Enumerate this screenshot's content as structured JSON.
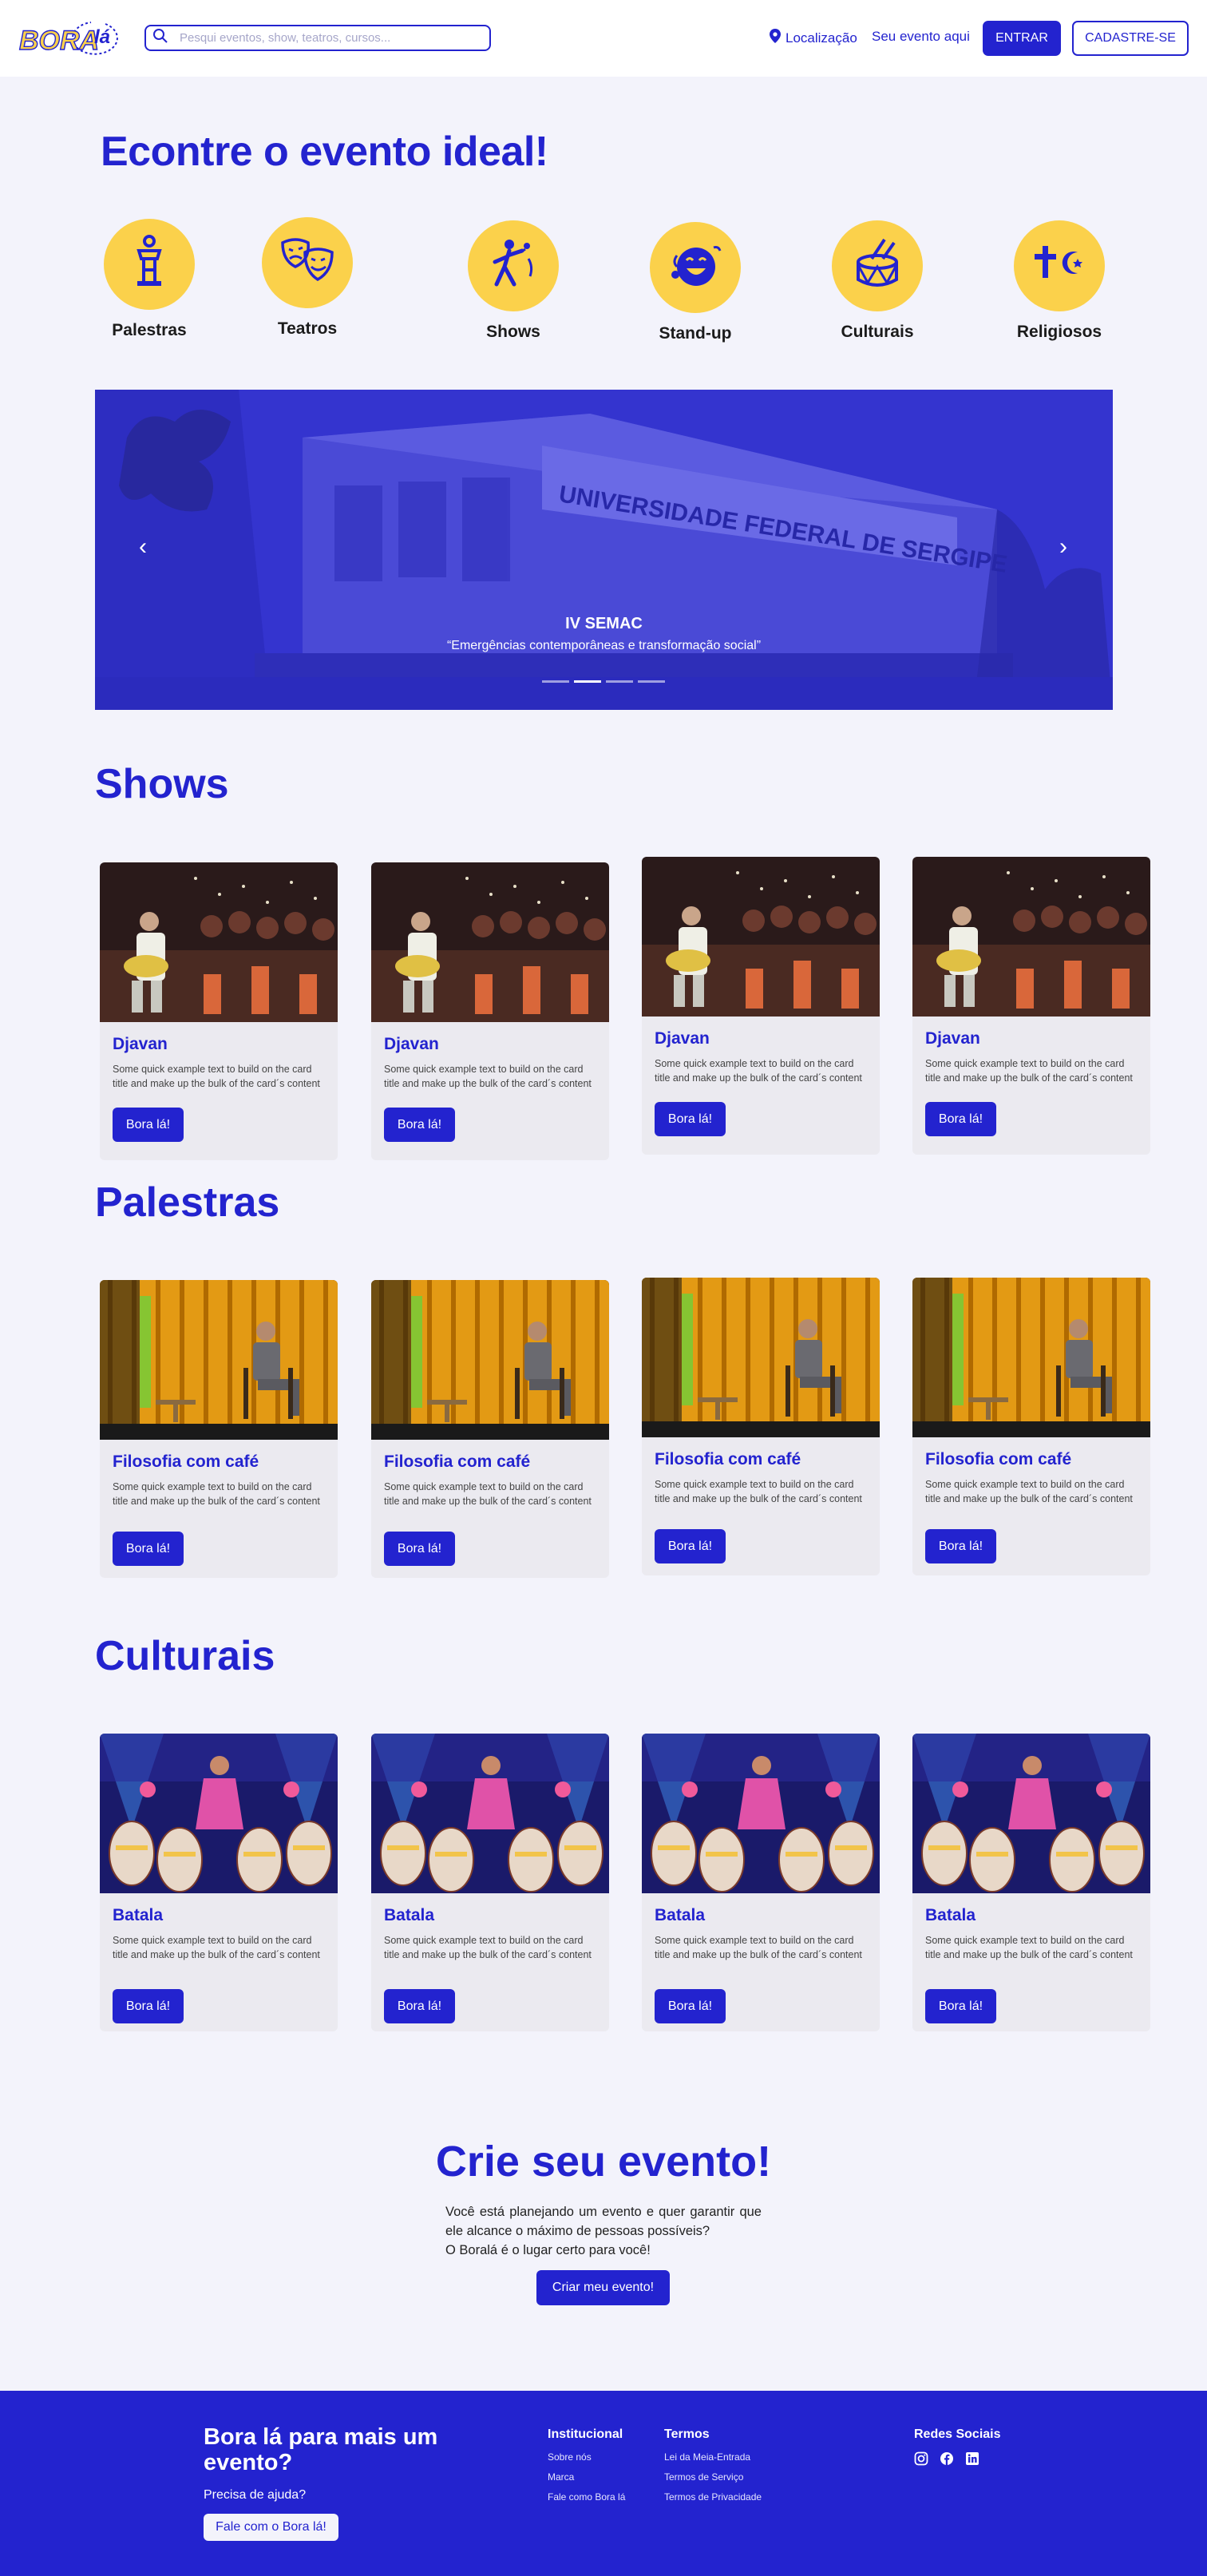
{
  "header": {
    "logo_text": "BORAlá",
    "search_placeholder": "Pesqui eventos, show, teatros, cursos...",
    "location_label": "Localização",
    "event_link": "Seu evento aqui",
    "login_button": "ENTRAR",
    "signup_button": "CADASTRE-SE"
  },
  "hero": {
    "title": "Econtre o evento ideal!"
  },
  "categories": [
    {
      "label": "Palestras",
      "icon": "lectern-icon"
    },
    {
      "label": "Teatros",
      "icon": "theater-masks-icon"
    },
    {
      "label": "Shows",
      "icon": "singer-microphone-icon"
    },
    {
      "label": "Stand-up",
      "icon": "laughing-face-icon"
    },
    {
      "label": "Culturais",
      "icon": "drum-icon"
    },
    {
      "label": "Religiosos",
      "icon": "religious-symbols-icon"
    }
  ],
  "carousel": {
    "banner_text": "UNIVERSIDADE FEDERAL DE SERGIPE",
    "title": "IV SEMAC",
    "subtitle": "“Emergências contemporâneas e transformação social”",
    "slides": 4,
    "active_slide": 2
  },
  "sections": {
    "shows": {
      "title": "Shows",
      "cards": [
        {
          "title": "Djavan",
          "text": "Some quick example text to build on the card title and make up the bulk of the card´s content",
          "button": "Bora lá!"
        },
        {
          "title": "Djavan",
          "text": "Some quick example text to build on the card title and make up the bulk of the card´s content",
          "button": "Bora lá!"
        },
        {
          "title": "Djavan",
          "text": "Some quick example text to build on the card title and make up the bulk of the card´s content",
          "button": "Bora lá!"
        },
        {
          "title": "Djavan",
          "text": "Some quick example text to build on the card title and make up the bulk of the card´s content",
          "button": "Bora lá!"
        }
      ]
    },
    "palestras": {
      "title": "Palestras",
      "cards": [
        {
          "title": "Filosofia com café",
          "text": "Some quick example text to build on the card title and make up the bulk of the card´s content",
          "button": "Bora lá!"
        },
        {
          "title": "Filosofia com café",
          "text": "Some quick example text to build on the card title and make up the bulk of the card´s content",
          "button": "Bora lá!"
        },
        {
          "title": "Filosofia com café",
          "text": "Some quick example text to build on the card title and make up the bulk of the card´s content",
          "button": "Bora lá!"
        },
        {
          "title": "Filosofia com café",
          "text": "Some quick example text to build on the card title and make up the bulk of the card´s content",
          "button": "Bora lá!"
        }
      ]
    },
    "culturais": {
      "title": "Culturais",
      "cards": [
        {
          "title": "Batala",
          "text": "Some quick example text to build on the card title and make up the bulk of the card´s content",
          "button": "Bora lá!"
        },
        {
          "title": "Batala",
          "text": "Some quick example text to build on the card title and make up the bulk of the card´s content",
          "button": "Bora lá!"
        },
        {
          "title": "Batala",
          "text": "Some quick example text to build on the card title and make up the bulk of the card´s content",
          "button": "Bora lá!"
        },
        {
          "title": "Batala",
          "text": "Some quick example text to build on the card title and make up the bulk of the card´s content",
          "button": "Bora lá!"
        }
      ]
    }
  },
  "create_event": {
    "title": "Crie seu evento!",
    "paragraph": "Você está planejando um evento e quer garantir que ele alcance o máximo de pessoas possíveis?",
    "paragraph2": "O Boralá é o lugar certo para você!",
    "button": "Criar meu evento!"
  },
  "footer": {
    "tagline": "Bora lá para mais um evento?",
    "help_text": "Precisa de ajuda?",
    "help_button": "Fale com o Bora lá!",
    "institucional": {
      "title": "Institucional",
      "links": [
        "Sobre nós",
        "Marca",
        "Fale como Bora lá"
      ]
    },
    "termos": {
      "title": "Termos",
      "links": [
        "Lei da Meia-Entrada",
        "Termos de Serviço",
        "Termos de Privacidade"
      ]
    },
    "social": {
      "title": "Redes Sociais",
      "icons": [
        "instagram-icon",
        "facebook-icon",
        "linkedin-icon"
      ]
    }
  },
  "colors": {
    "brand_blue": "#2323cf",
    "accent_yellow": "#fbd14b",
    "background": "#f3f3fb",
    "card_bg": "#ebeaf0"
  }
}
